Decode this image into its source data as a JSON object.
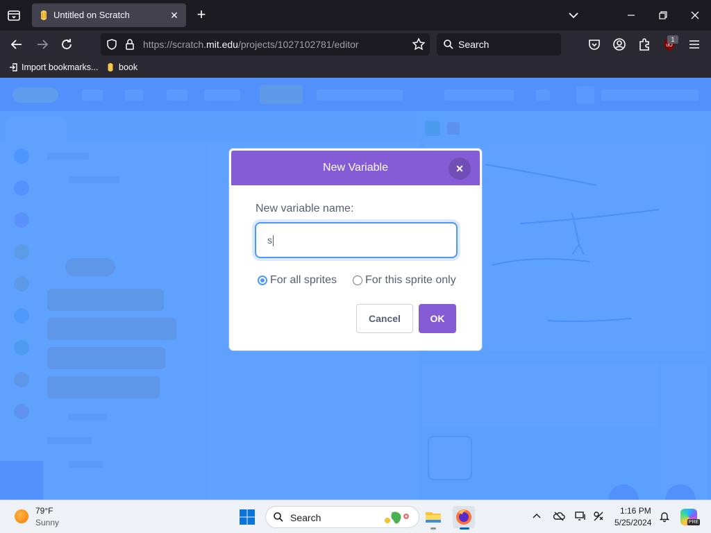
{
  "browser": {
    "tab": {
      "title": "Untitled on Scratch"
    },
    "url": {
      "prefix": "https://scratch.",
      "host": "mit.edu",
      "path": "/projects/1027102781/editor"
    },
    "search_label": "Search",
    "ublock_count": "1",
    "bookmarks": [
      {
        "label": "Import bookmarks..."
      },
      {
        "label": "book"
      }
    ]
  },
  "dialog": {
    "title": "New Variable",
    "field_label": "New variable name:",
    "input_value": "s",
    "options": [
      {
        "label": "For all sprites",
        "checked": true
      },
      {
        "label": "For this sprite only",
        "checked": false
      }
    ],
    "cancel_label": "Cancel",
    "ok_label": "OK"
  },
  "taskbar": {
    "weather": {
      "temp": "79°F",
      "condition": "Sunny"
    },
    "search_label": "Search",
    "clock": {
      "time": "1:16 PM",
      "date": "5/25/2024"
    },
    "copilot_badge": "PRE"
  },
  "colors": {
    "scratch_purple": "#855cd6",
    "scratch_blue": "#4c97ff",
    "overlay": "#4d97ff"
  }
}
